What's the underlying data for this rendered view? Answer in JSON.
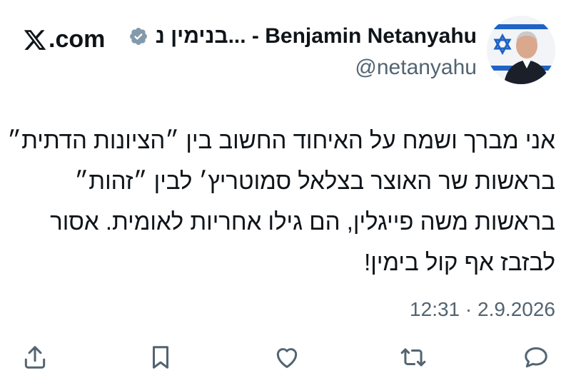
{
  "header": {
    "site_logo_text": ".com",
    "display_name": "בנימין נ... - Benjamin Netanyahu",
    "handle": "@netanyahu",
    "verified": true
  },
  "tweet": {
    "lines": [
      "אני מברך ושמח על האיחוד החשוב בין ״הציונות הדתית״",
      "בראשות שר האוצר בצלאל סמוטריץ׳ לבין ״זהות״",
      "בראשות משה פייגלין, הם גילו אחריות לאומית. אסור",
      "לבזבז אף קול בימין!"
    ],
    "timestamp": "12:31 · 2.9.2026"
  },
  "actions": {
    "icons": [
      "share-icon",
      "bookmark-icon",
      "like-icon",
      "retweet-icon",
      "reply-icon"
    ]
  },
  "colors": {
    "text": "#0f1419",
    "secondary": "#536471",
    "verified_badge": "#829aab",
    "flag_blue": "#1f63c6"
  }
}
